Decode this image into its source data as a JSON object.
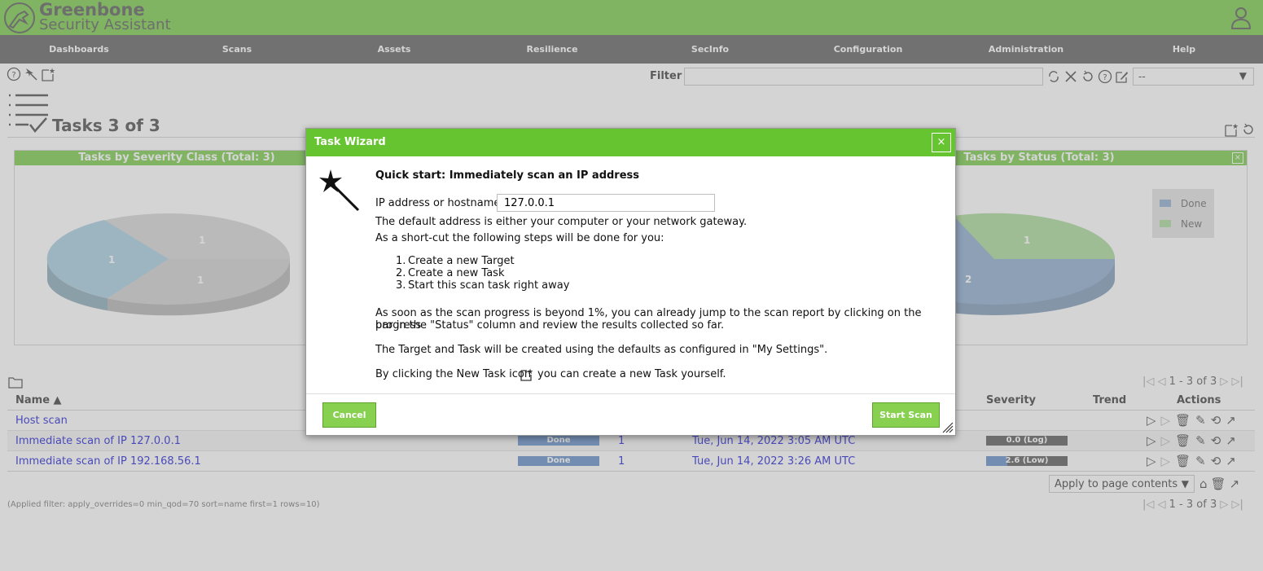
{
  "header": {
    "brand_line1": "Greenbone",
    "brand_line2": "Security Assistant"
  },
  "menu": [
    "Dashboards",
    "Scans",
    "Assets",
    "Resilience",
    "SecInfo",
    "Configuration",
    "Administration",
    "Help"
  ],
  "filter": {
    "label": "Filter",
    "value": "",
    "select_value": "--"
  },
  "page": {
    "title": "Tasks 3 of 3"
  },
  "charts": {
    "left_title": "Tasks by Severity Class (Total: 3)",
    "right_title": "Tasks by Status (Total: 3)",
    "left_slices": [
      {
        "label": "1",
        "color": "#9ac7dc"
      },
      {
        "label": "1",
        "color": "#cfcfcf"
      },
      {
        "label": "1",
        "color": "#c8c8c8"
      }
    ],
    "right_slices": [
      {
        "label": "1",
        "color": "#9fd68a"
      },
      {
        "label": "2",
        "color": "#7ea0c8"
      }
    ],
    "legend": [
      {
        "label": "Done",
        "color": "#7ea0c8"
      },
      {
        "label": "New",
        "color": "#9fd68a"
      }
    ]
  },
  "table": {
    "pager_top": "1 - 3 of 3",
    "pager_bottom": "1 - 3 of 3",
    "headers": {
      "name": "Name ▲",
      "severity": "Severity",
      "trend": "Trend",
      "actions": "Actions"
    },
    "rows": [
      {
        "name": "Host scan",
        "status": "",
        "reports": "",
        "last": "",
        "severity": ""
      },
      {
        "name": "Immediate scan of IP 127.0.0.1",
        "status": "Done",
        "reports": "1",
        "last": "Tue, Jun 14, 2022 3:05 AM UTC",
        "severity": "0.0 (Log)"
      },
      {
        "name": "Immediate scan of IP 192.168.56.1",
        "status": "Done",
        "reports": "1",
        "last": "Tue, Jun 14, 2022 3:26 AM UTC",
        "severity": "2.6 (Low)"
      }
    ],
    "bulk_select": "Apply to page contents",
    "applied_filter": "(Applied filter: apply_overrides=0 min_qod=70 sort=name first=1 rows=10)"
  },
  "dialog": {
    "title": "Task Wizard",
    "close": "×",
    "heading": "Quick start: Immediately scan an IP address",
    "ip_label": "IP address or hostname:",
    "ip_value": "127.0.0.1",
    "default_text": "The default address is either your computer or your network gateway.",
    "shortcut_text": "As a short-cut the following steps will be done for you:",
    "steps": [
      "Create a new Target",
      "Create a new Task",
      "Start this scan task right away"
    ],
    "progress_text_1": "As soon as the scan progress is beyond 1%, you can already jump to the scan report by clicking on the progress",
    "progress_text_2": "bar in the \"Status\" column and review the results collected so far.",
    "defaults_text": "The Target and Task will be created using the defaults as configured in \"My Settings\".",
    "new_task_text_1": "By clicking the New Task icon",
    "new_task_text_2": "you can create a new Task yourself.",
    "cancel": "Cancel",
    "start": "Start Scan"
  }
}
